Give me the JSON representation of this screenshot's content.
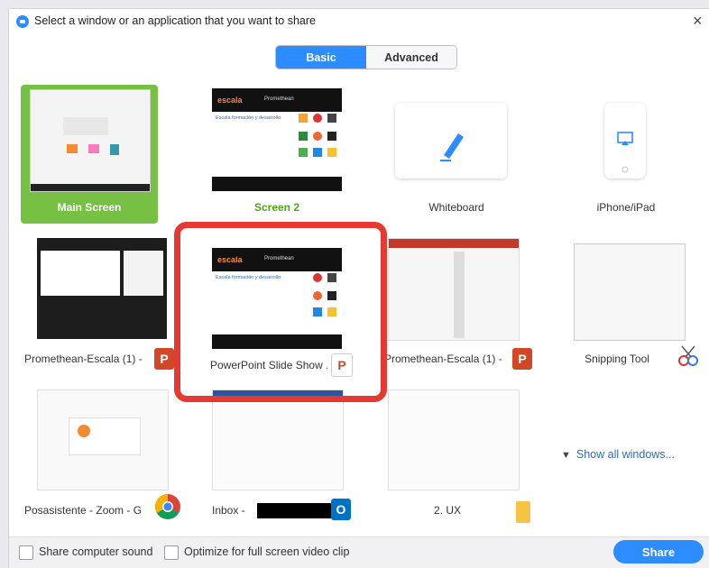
{
  "window": {
    "title": "Select a window or an application that you want to share",
    "close": "×"
  },
  "tabs": [
    {
      "label": "Basic",
      "active": true
    },
    {
      "label": "Advanced",
      "active": false
    }
  ],
  "tiles": [
    {
      "label": "Main Screen",
      "selected": true
    },
    {
      "label": "Screen 2"
    },
    {
      "label": "Whiteboard"
    },
    {
      "label": "iPhone/iPad"
    },
    {
      "label": "Promethean-Escala (1) - ...",
      "app_icon": "powerpoint-icon"
    },
    {
      "label": "PowerPoint Slide Show ...",
      "app_icon": "powerpoint-show-icon"
    },
    {
      "label": "Promethean-Escala (1) - ...",
      "app_icon": "powerpoint-icon"
    },
    {
      "label": "Snipping Tool",
      "app_icon": "scissors-icon"
    },
    {
      "label": "Posasistente - Zoom - G...",
      "app_icon": "chrome-icon"
    },
    {
      "label": "Inbox - ",
      "app_icon": "outlook-icon"
    },
    {
      "label": "2. UX",
      "app_icon": "folder-icon"
    }
  ],
  "show_all": "Show all windows...",
  "footer": {
    "share_sound": "Share computer sound",
    "optimize": "Optimize for full screen video clip",
    "share_button": "Share"
  },
  "thumb_texts": {
    "escala_logo": "escala",
    "promethean": "Promethean",
    "escala_sub": "Escala formación y desarrollo"
  },
  "badges": {
    "ppt": "P",
    "outlook": "O"
  },
  "colors": {
    "accent": "#2d8cff",
    "selected": "#76c043",
    "highlight": "#e53a32",
    "ppt": "#d24726"
  }
}
